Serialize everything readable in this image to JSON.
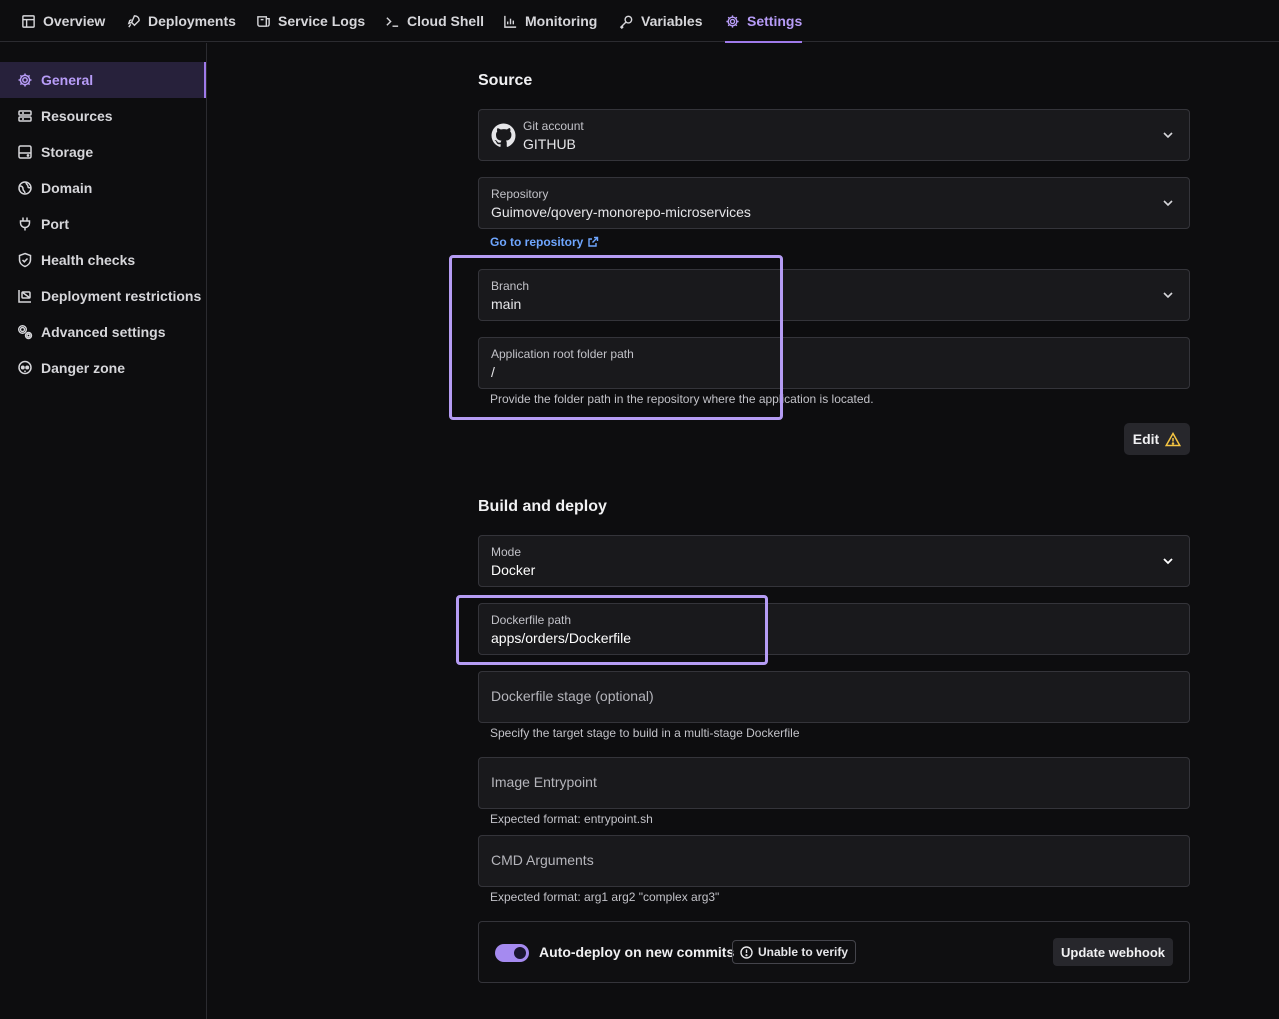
{
  "nav": {
    "tabs": [
      {
        "label": "Overview",
        "icon": "overview-icon"
      },
      {
        "label": "Deployments",
        "icon": "rocket-icon"
      },
      {
        "label": "Service Logs",
        "icon": "logs-icon"
      },
      {
        "label": "Cloud Shell",
        "icon": "terminal-icon"
      },
      {
        "label": "Monitoring",
        "icon": "chart-icon"
      },
      {
        "label": "Variables",
        "icon": "key-icon"
      },
      {
        "label": "Settings",
        "icon": "gear-icon",
        "active": true
      }
    ]
  },
  "sidebar": {
    "items": [
      {
        "label": "General",
        "icon": "gear-icon",
        "active": true
      },
      {
        "label": "Resources",
        "icon": "resources-icon"
      },
      {
        "label": "Storage",
        "icon": "storage-icon"
      },
      {
        "label": "Domain",
        "icon": "globe-icon"
      },
      {
        "label": "Port",
        "icon": "plug-icon"
      },
      {
        "label": "Health checks",
        "icon": "shield-icon"
      },
      {
        "label": "Deployment restrictions",
        "icon": "restrictions-icon"
      },
      {
        "label": "Advanced settings",
        "icon": "cogs-icon"
      },
      {
        "label": "Danger zone",
        "icon": "skull-icon"
      }
    ]
  },
  "source": {
    "title": "Source",
    "git_account": {
      "label": "Git account",
      "value": "GITHUB"
    },
    "repository": {
      "label": "Repository",
      "value": "Guimove/qovery-monorepo-microservices"
    },
    "go_to_repository": "Go to repository",
    "branch": {
      "label": "Branch",
      "value": "main"
    },
    "root_path": {
      "label": "Application root folder path",
      "value": "/",
      "hint": "Provide the folder path in the repository where the application is located."
    },
    "edit_label": "Edit"
  },
  "build": {
    "title": "Build and deploy",
    "mode": {
      "label": "Mode",
      "value": "Docker"
    },
    "dockerfile_path": {
      "label": "Dockerfile path",
      "value": "apps/orders/Dockerfile"
    },
    "dockerfile_stage": {
      "placeholder": "Dockerfile stage (optional)",
      "hint": "Specify the target stage to build in a multi-stage Dockerfile"
    },
    "entrypoint": {
      "placeholder": "Image Entrypoint",
      "hint": "Expected format: entrypoint.sh"
    },
    "cmd_args": {
      "placeholder": "CMD Arguments",
      "hint": "Expected format: arg1 arg2 \"complex arg3\""
    },
    "auto_deploy": {
      "label": "Auto-deploy on new commits",
      "enabled": true,
      "badge": "Unable to verify",
      "webhook_button": "Update webhook"
    }
  },
  "colors": {
    "accent": "#9f7aea",
    "highlight": "#b59cf4",
    "link": "#6fa6ff",
    "warning": "#f5c542"
  }
}
